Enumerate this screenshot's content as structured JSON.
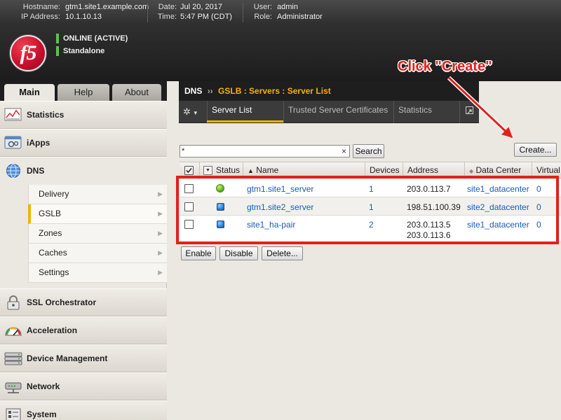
{
  "top_bar": {
    "hostname_label": "Hostname:",
    "hostname": "gtm1.site1.example.com",
    "ip_label": "IP Address:",
    "ip": "10.1.10.13",
    "date_label": "Date:",
    "date": "Jul 20, 2017",
    "time_label": "Time:",
    "time": "5:47 PM (CDT)",
    "user_label": "User:",
    "user": "admin",
    "role_label": "Role:",
    "role": "Administrator"
  },
  "header": {
    "logo": "f5",
    "status": "ONLINE (ACTIVE)",
    "mode": "Standalone",
    "status_color": "#5cc44e"
  },
  "left_tabs": [
    {
      "label": "Main",
      "active": true
    },
    {
      "label": "Help",
      "active": false
    },
    {
      "label": "About",
      "active": false
    }
  ],
  "sidebar": {
    "items": [
      {
        "label": "Statistics",
        "icon": "statistics-icon"
      },
      {
        "label": "iApps",
        "icon": "iapps-icon"
      },
      {
        "label": "DNS",
        "icon": "globe-icon"
      },
      {
        "label": "SSL Orchestrator",
        "icon": "lock-icon"
      },
      {
        "label": "Acceleration",
        "icon": "gauge-icon"
      },
      {
        "label": "Device Management",
        "icon": "device-icon"
      },
      {
        "label": "Network",
        "icon": "network-icon"
      },
      {
        "label": "System",
        "icon": "system-icon"
      }
    ],
    "dns_subitems": [
      {
        "label": "Delivery",
        "selected": false
      },
      {
        "label": "GSLB",
        "selected": true
      },
      {
        "label": "Zones",
        "selected": false
      },
      {
        "label": "Caches",
        "selected": false
      },
      {
        "label": "Settings",
        "selected": false
      }
    ]
  },
  "breadcrumb": {
    "root": "DNS",
    "sep": "››",
    "path": "GSLB : Servers : Server List"
  },
  "subtabs": [
    {
      "label": "Server List",
      "active": true
    },
    {
      "label": "Trusted Server Certificates",
      "active": false
    },
    {
      "label": "Statistics",
      "active": false
    }
  ],
  "filter": {
    "value": "*",
    "clear": "×",
    "search_label": "Search"
  },
  "create_label": "Create...",
  "table": {
    "columns": [
      "Status",
      "Name",
      "Devices",
      "Address",
      "Data Center",
      "Virtual"
    ],
    "rows": [
      {
        "status": "available",
        "name": "gtm1.site1_server",
        "devices": "1",
        "address": [
          "203.0.113.7"
        ],
        "data_center": "site1_datacenter",
        "virtual": "0"
      },
      {
        "status": "unknown",
        "name": "gtm1.site2_server",
        "devices": "1",
        "address": [
          "198.51.100.39"
        ],
        "data_center": "site2_datacenter",
        "virtual": "0"
      },
      {
        "status": "unknown",
        "name": "site1_ha-pair",
        "devices": "2",
        "address": [
          "203.0.113.5",
          "203.0.113.6"
        ],
        "data_center": "site1_datacenter",
        "virtual": "0"
      }
    ]
  },
  "actions": [
    {
      "label": "Enable"
    },
    {
      "label": "Disable"
    },
    {
      "label": "Delete..."
    }
  ],
  "annotation": {
    "text": "Click \"Create\"",
    "color": "#e3201b"
  }
}
